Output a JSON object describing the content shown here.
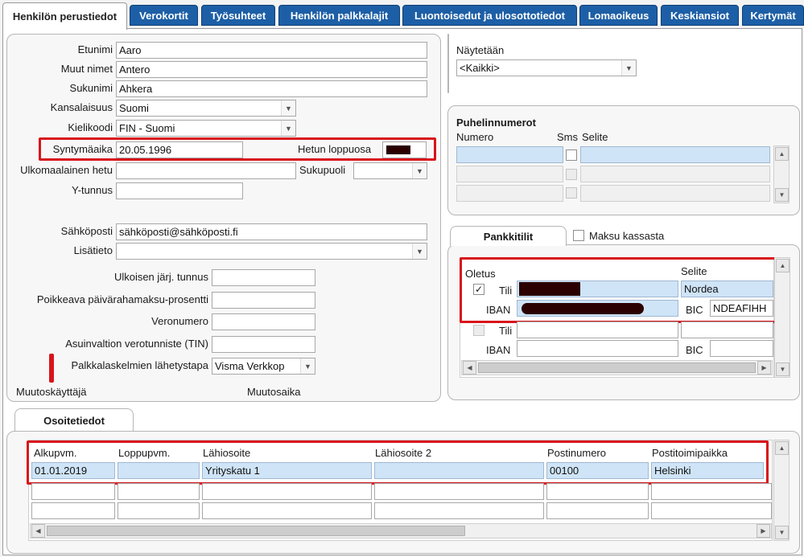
{
  "tabs": [
    {
      "label": "Henkilön perustiedot",
      "active": true
    },
    {
      "label": "Verokortit"
    },
    {
      "label": "Työsuhteet"
    },
    {
      "label": "Henkilön palkkalajit"
    },
    {
      "label": "Luontoisedut ja ulosottotiedot"
    },
    {
      "label": "Lomaoikeus"
    },
    {
      "label": "Keskiansiot"
    },
    {
      "label": "Kertymät"
    }
  ],
  "person": {
    "etunimi_label": "Etunimi",
    "etunimi": "Aaro",
    "muut_nimet_label": "Muut nimet",
    "muut_nimet": "Antero",
    "sukunimi_label": "Sukunimi",
    "sukunimi": "Ahkera",
    "kansalaisuus_label": "Kansalaisuus",
    "kansalaisuus": "Suomi",
    "kielikoodi_label": "Kielikoodi",
    "kielikoodi": "FIN - Suomi",
    "syntymaaika_label": "Syntymäaika",
    "syntymaaika": "20.05.1996",
    "hetun_loppuosa_label": "Hetun loppuosa",
    "ulkomaalainen_hetu_label": "Ulkomaalainen hetu",
    "sukupuoli_label": "Sukupuoli",
    "ytunnus_label": "Y-tunnus",
    "sahkoposti_label": "Sähköposti",
    "sahkoposti": "sähköposti@sähköposti.fi",
    "lisatieto_label": "Lisätieto",
    "ulkoisen_label": "Ulkoisen järj. tunnus",
    "poikkeava_label": "Poikkeava päivärahamaksu-prosentti",
    "veronumero_label": "Veronumero",
    "asuinvaltion_label": "Asuinvaltion verotunniste (TIN)",
    "lahetystapa_label": "Palkkalaskelmien lähetystapa",
    "lahetystapa": "Visma Verkkop",
    "muutoskayttaja_label": "Muutoskäyttäjä",
    "muutosaika_label": "Muutosaika"
  },
  "naytetaan": {
    "label": "Näytetään",
    "value": "<Kaikki>"
  },
  "phones": {
    "title": "Puhelinnumerot",
    "col_numero": "Numero",
    "col_sms": "Sms",
    "col_selite": "Selite"
  },
  "bank": {
    "tab_label": "Pankkitilit",
    "maksu_kassasta_label": "Maksu kassasta",
    "oletus_label": "Oletus",
    "selite_header": "Selite",
    "tili_label": "Tili",
    "iban_label": "IBAN",
    "bic_label": "BIC",
    "account1": {
      "checked": "✓",
      "selite": "Nordea",
      "bic": "NDEAFIHH"
    }
  },
  "address": {
    "tab_label": "Osoitetiedot",
    "headers": [
      "Alkupvm.",
      "Loppupvm.",
      "Lähiosoite",
      "Lähiosoite 2",
      "Postinumero",
      "Postitoimipaikka"
    ],
    "row1": [
      "01.01.2019",
      "",
      "Yrityskatu 1",
      "",
      "00100",
      "Helsinki"
    ]
  },
  "icons": {
    "combo": "chevron-down-icon",
    "scroll_up": "triangle-up-icon",
    "scroll_down": "triangle-down-icon",
    "scroll_left": "triangle-left-icon",
    "scroll_right": "triangle-right-icon"
  },
  "colors": {
    "tab_blue": "#1d5fa6",
    "field_blue": "#cfe4f7",
    "highlight_red": "#d8141b"
  }
}
